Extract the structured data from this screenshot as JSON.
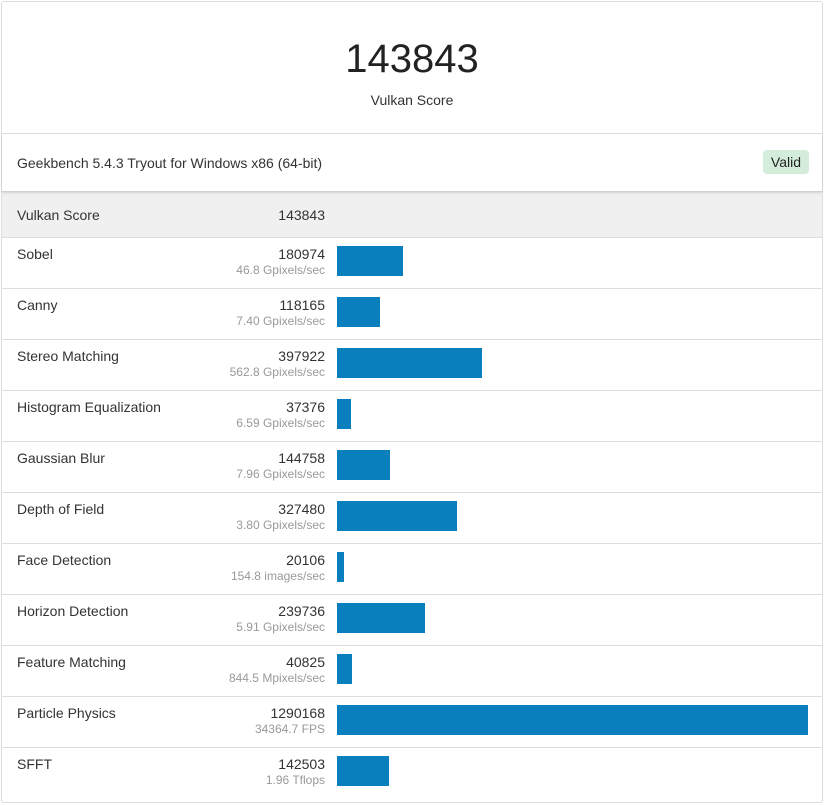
{
  "header": {
    "score": "143843",
    "score_label": "Vulkan Score"
  },
  "info": {
    "version_text": "Geekbench 5.4.3 Tryout for Windows x86 (64-bit)",
    "status_badge": "Valid"
  },
  "colors": {
    "bar": "#0a7fbe",
    "valid_badge_bg": "#d4edda"
  },
  "total": {
    "name": "Vulkan Score",
    "score": "143843"
  },
  "benchmarks": [
    {
      "name": "Sobel",
      "score": "180974",
      "rate": "46.8 Gpixels/sec",
      "value": 180974
    },
    {
      "name": "Canny",
      "score": "118165",
      "rate": "7.40 Gpixels/sec",
      "value": 118165
    },
    {
      "name": "Stereo Matching",
      "score": "397922",
      "rate": "562.8 Gpixels/sec",
      "value": 397922
    },
    {
      "name": "Histogram Equalization",
      "score": "37376",
      "rate": "6.59 Gpixels/sec",
      "value": 37376
    },
    {
      "name": "Gaussian Blur",
      "score": "144758",
      "rate": "7.96 Gpixels/sec",
      "value": 144758
    },
    {
      "name": "Depth of Field",
      "score": "327480",
      "rate": "3.80 Gpixels/sec",
      "value": 327480
    },
    {
      "name": "Face Detection",
      "score": "20106",
      "rate": "154.8 images/sec",
      "value": 20106
    },
    {
      "name": "Horizon Detection",
      "score": "239736",
      "rate": "5.91 Gpixels/sec",
      "value": 239736
    },
    {
      "name": "Feature Matching",
      "score": "40825",
      "rate": "844.5 Mpixels/sec",
      "value": 40825
    },
    {
      "name": "Particle Physics",
      "score": "1290168",
      "rate": "34364.7 FPS",
      "value": 1290168
    },
    {
      "name": "SFFT",
      "score": "142503",
      "rate": "1.96 Tflops",
      "value": 142503
    }
  ]
}
